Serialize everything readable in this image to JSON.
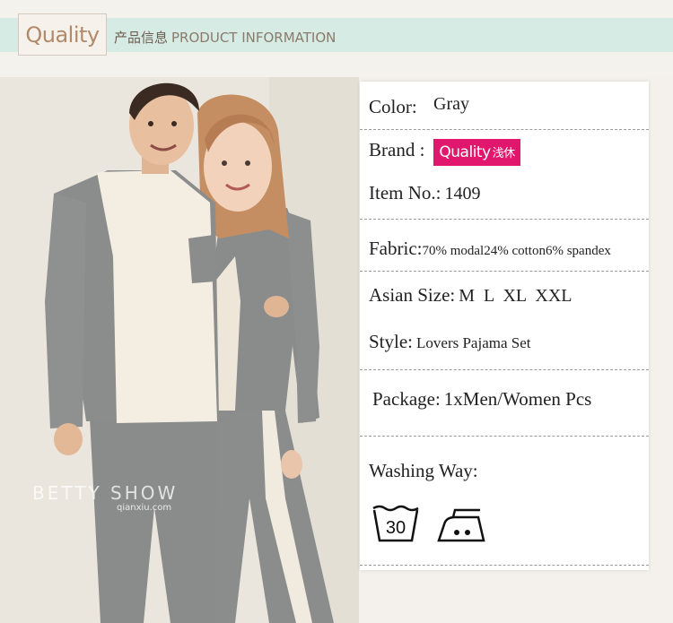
{
  "header": {
    "logo_text": "Quality",
    "title_cn": "产品信息",
    "title_en": "PRODUCT INFORMATION"
  },
  "photo": {
    "watermark": "BETTY SHOW",
    "watermark_url": "qianxiu.com"
  },
  "info": {
    "color_label": "Color:",
    "color_value": "Gray",
    "brand_label": "Brand :",
    "brand_logo_text": "Quality",
    "brand_logo_cn": "浅休",
    "item_label": "Item No.:",
    "item_value": "1409",
    "fabric_label": "Fabric:",
    "fabric_value": "70% modal24% cotton6% spandex",
    "size_label": "Asian Size:",
    "size_value": "M  L  XL  XXL",
    "style_label": "Style:",
    "style_value": "Lovers Pajama Set",
    "package_label": "Package:",
    "package_value": "1xMen/Women Pcs",
    "washing_label": "Washing Way:",
    "wash_temp": "30"
  },
  "colors": {
    "accent_band": "#d6ebe3",
    "brand_pink": "#e0176c",
    "pajama_gray": "#8a8c8b",
    "pajama_cream": "#f3ece0"
  },
  "icons": [
    "wash-30-icon",
    "iron-medium-icon"
  ]
}
